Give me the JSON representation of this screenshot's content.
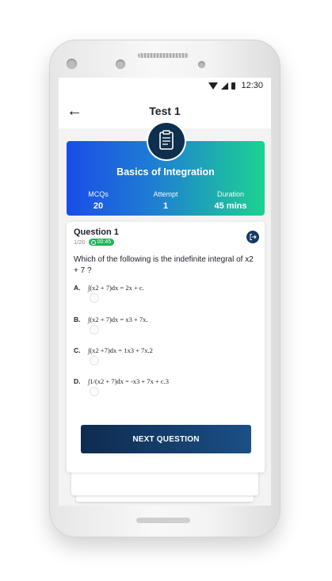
{
  "status_bar": {
    "time": "12:30"
  },
  "header": {
    "title": "Test 1"
  },
  "test_info": {
    "name": "Basics of Integration",
    "stats": [
      {
        "label": "MCQs",
        "value": "20"
      },
      {
        "label": "Attempt",
        "value": "1"
      },
      {
        "label": "Duration",
        "value": "45 mins"
      }
    ]
  },
  "question": {
    "label": "Question 1",
    "progress": "1/20",
    "timer": "00:45",
    "text": "Which of the following is the indefinite integral of x2 + 7 ?",
    "options": [
      {
        "letter": "A.",
        "text": "∫(x2 + 7)dx = 2x + c."
      },
      {
        "letter": "B.",
        "text": "∫(x2 + 7)dx = x3 + 7x."
      },
      {
        "letter": "C.",
        "text": "∫(x2 +7)dx = 1x3 + 7x.2"
      },
      {
        "letter": "D.",
        "text": "∫1/(x2 + 7)dx = -x3 + 7x + c.3"
      }
    ]
  },
  "actions": {
    "next_label": "NEXT QUESTION"
  }
}
